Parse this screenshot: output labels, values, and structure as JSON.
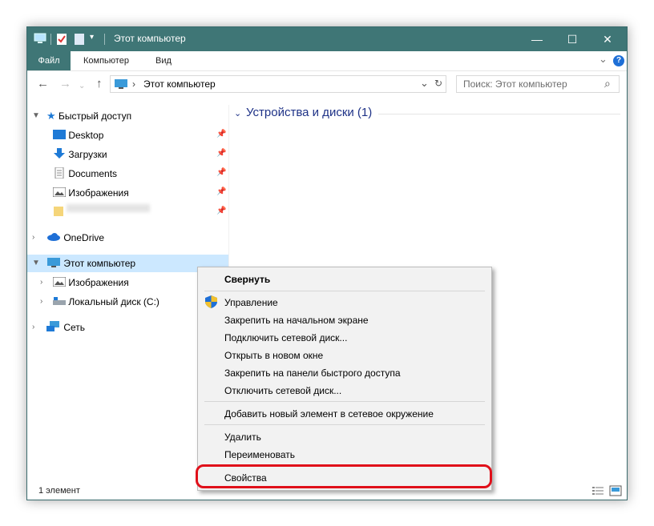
{
  "window": {
    "title": "Этот компьютер",
    "minimize": "—",
    "maximize": "☐",
    "close": "✕"
  },
  "ribbon": {
    "tabs": [
      "Файл",
      "Компьютер",
      "Вид"
    ],
    "expand": "⌄",
    "help": "?"
  },
  "toolbar": {
    "back": "←",
    "forward": "→",
    "up": "↑",
    "address_separator": "›",
    "address": "Этот компьютер",
    "address_dropdown": "⌄",
    "refresh": "↻",
    "search_placeholder": "Поиск: Этот компьютер",
    "search_icon": "⌕"
  },
  "nav": {
    "quick_access": "Быстрый доступ",
    "quick_items": [
      "Desktop",
      "Загрузки",
      "Documents",
      "Изображения",
      " "
    ],
    "onedrive": "OneDrive",
    "this_pc": "Этот компьютер",
    "pc_items": [
      "Изображения",
      "Локальный диск (C:)"
    ],
    "network": "Сеть"
  },
  "main": {
    "section_title": "Устройства и диски (1)"
  },
  "status": {
    "count": "1 элемент"
  },
  "context_menu": {
    "collapse": "Свернуть",
    "manage": "Управление",
    "pin_start": "Закрепить на начальном экране",
    "map_drive": "Подключить сетевой диск...",
    "open_new_window": "Открыть в новом окне",
    "pin_quick": "Закрепить на панели быстрого доступа",
    "disconnect_drive": "Отключить сетевой диск...",
    "add_network_location": "Добавить новый элемент в сетевое окружение",
    "delete": "Удалить",
    "rename": "Переименовать",
    "properties": "Свойства"
  },
  "icons": {
    "pin": "pin-icon",
    "chevron": "chevron-icon",
    "star": "star-icon",
    "folder": "folder-icon",
    "pc": "computer-icon",
    "cloud": "cloud-icon",
    "network": "network-icon",
    "drive": "drive-icon",
    "shield": "shield-icon"
  },
  "colors": {
    "titlebar": "#3f7676",
    "section_title": "#1e3287",
    "highlight": "#e0101a"
  }
}
